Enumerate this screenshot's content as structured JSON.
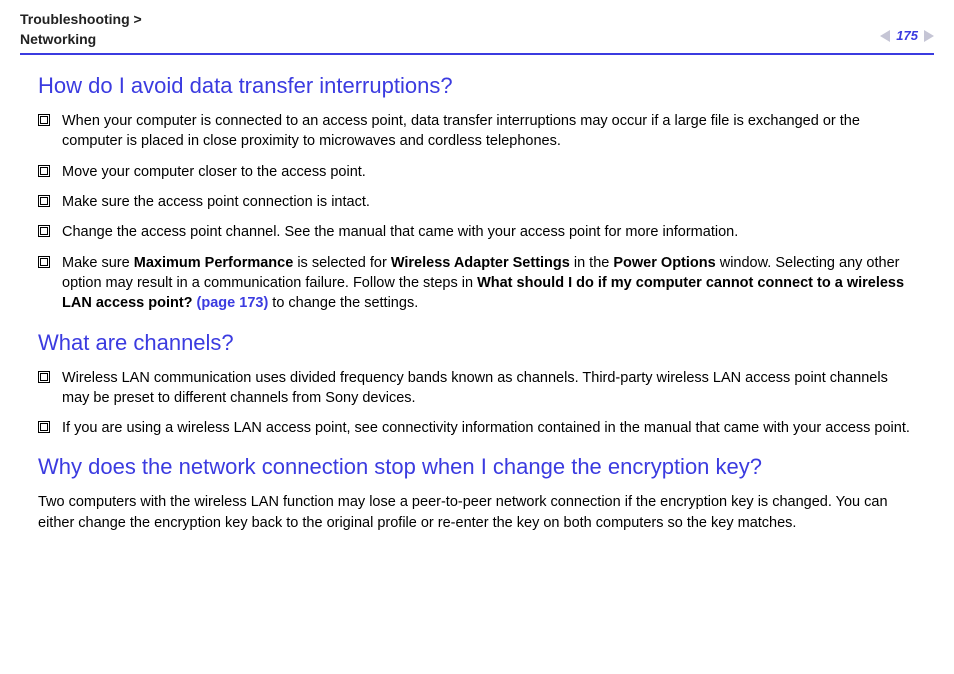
{
  "header": {
    "breadcrumb1": "Troubleshooting",
    "breadcrumb_sep": ">",
    "breadcrumb2": "Networking",
    "page_number": "175"
  },
  "section1": {
    "heading": "How do I avoid data transfer interruptions?",
    "items": [
      {
        "text": "When your computer is connected to an access point, data transfer interruptions may occur if a large file is exchanged or the computer is placed in close proximity to microwaves and cordless telephones."
      },
      {
        "text": "Move your computer closer to the access point."
      },
      {
        "text": "Change the access point channel. See the manual that came with your access point for more information."
      },
      {
        "p1": "Make sure ",
        "b1": "Maximum Performance",
        "p2": " is selected for ",
        "b2": "Wireless Adapter Settings",
        "p3": " in the ",
        "b3": "Power Options",
        "p4": " window. Selecting any other option may result in a communication failure. Follow the steps in ",
        "b4": "What should I do if my computer cannot connect to a wireless LAN access point?",
        "link": " (page 173)",
        "p5": " to change the settings."
      }
    ],
    "item_intact": "Make sure the access point connection is intact."
  },
  "section2": {
    "heading": "What are channels?",
    "items": [
      "Wireless LAN communication uses divided frequency bands known as channels. Third-party wireless LAN access point channels may be preset to different channels from Sony devices.",
      "If you are using a wireless LAN access point, see connectivity information contained in the manual that came with your access point."
    ]
  },
  "section3": {
    "heading": "Why does the network connection stop when I change the encryption key?",
    "body": "Two computers with the wireless LAN function may lose a peer-to-peer network connection if the encryption key is changed. You can either change the encryption key back to the original profile or re-enter the key on both computers so the key matches."
  }
}
